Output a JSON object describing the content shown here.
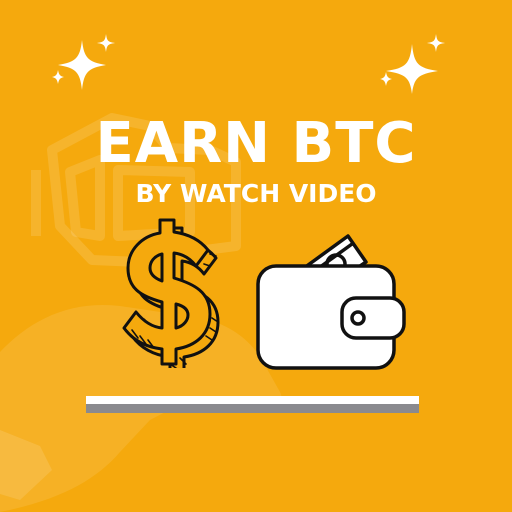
{
  "headline": "EARN BTC",
  "subheadline": "BY WATCH VIDEO",
  "icons": {
    "left": "dollar-sign-icon",
    "right": "wallet-icon",
    "decorative": [
      "sparkle-icon",
      "sparkle-icon",
      "faded-cash-hand-icon"
    ]
  },
  "colors": {
    "background": "#f5a90d",
    "text": "#ffffff",
    "icon_stroke": "#111111",
    "bar_top": "#ffffff",
    "bar_bottom": "#8a8a8f"
  }
}
